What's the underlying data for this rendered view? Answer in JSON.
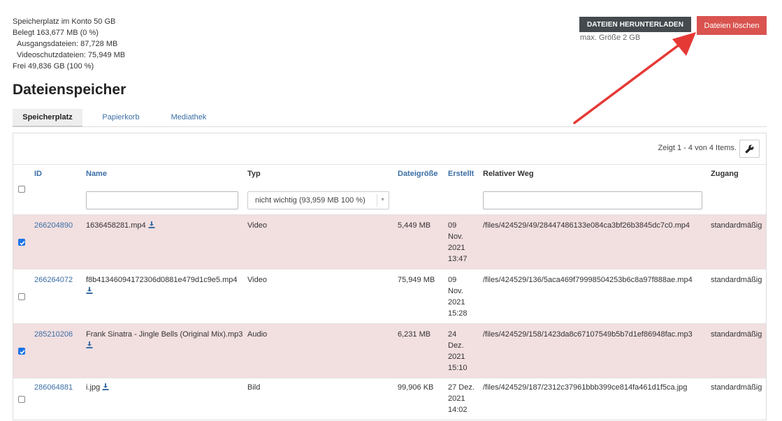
{
  "storage": {
    "quota": "Speicherplatz im Konto 50 GB",
    "used": "Belegt 163,677 MB (0 %)",
    "source_files": "Ausgangsdateien: 87,728 MB",
    "video_protection": "Videoschutzdateien: 75,949 MB",
    "free": "Frei 49,836 GB (100 %)"
  },
  "actions": {
    "download_label": "DATEIEN HERUNTERLADEN",
    "max_size": "max. Größe 2 GB",
    "delete_label": "Dateien löschen"
  },
  "page_title": "Dateienspeicher",
  "tabs": [
    {
      "label": "Speicherplatz",
      "active": true
    },
    {
      "label": "Papierkorb",
      "active": false
    },
    {
      "label": "Mediathek",
      "active": false
    }
  ],
  "table": {
    "showing": "Zeigt 1 - 4 von 4 Items.",
    "headers": {
      "id": "ID",
      "name": "Name",
      "type": "Typ",
      "size": "Dateigröße",
      "created": "Erstellt",
      "path": "Relativer Weg",
      "access": "Zugang"
    },
    "filters": {
      "name": "",
      "type_selected": "nicht wichtig (93,959 MB 100 %)",
      "path": ""
    },
    "rows": [
      {
        "checked": true,
        "id": "266204890",
        "name": "1636458281.mp4",
        "type": "Video",
        "size": "5,449 MB",
        "created": [
          "09",
          "Nov.",
          "2021",
          "13:47"
        ],
        "path": "/files/424529/49/28447486133e084ca3bf26b3845dc7c0.mp4",
        "access": "standardmäßig"
      },
      {
        "checked": false,
        "id": "266264072",
        "name": "f8b41346094172306d0881e479d1c9e5.mp4",
        "type": "Video",
        "size": "75,949 MB",
        "created": [
          "09",
          "Nov.",
          "2021",
          "15:28"
        ],
        "path": "/files/424529/136/5aca469f79998504253b6c8a97f888ae.mp4",
        "access": "standardmäßig"
      },
      {
        "checked": true,
        "id": "285210206",
        "name": "Frank Sinatra - Jingle Bells (Original Mix).mp3",
        "type": "Audio",
        "size": "6,231 MB",
        "created": [
          "24",
          "Dez.",
          "2021",
          "15:10"
        ],
        "path": "/files/424529/158/1423da8c67107549b5b7d1ef86948fac.mp3",
        "access": "standardmäßig"
      },
      {
        "checked": false,
        "id": "286064881",
        "name": "i.jpg",
        "type": "Bild",
        "size": "99,906 KB",
        "created": [
          "27 Dez.",
          "2021",
          "14:02"
        ],
        "path": "/files/424529/187/2312c37961bbb399ce814fa461d1f5ca.jpg",
        "access": "standardmäßig"
      }
    ]
  },
  "icons": {
    "download": "download-icon",
    "wrench": "wrench-icon",
    "arrow": "red-arrow-annotation"
  },
  "colors": {
    "link": "#3b6ea5",
    "delete_button": "#d9534f",
    "download_button": "#444a4e",
    "selected_row": "#f2dfe0",
    "annotation_arrow": "#e53935"
  }
}
